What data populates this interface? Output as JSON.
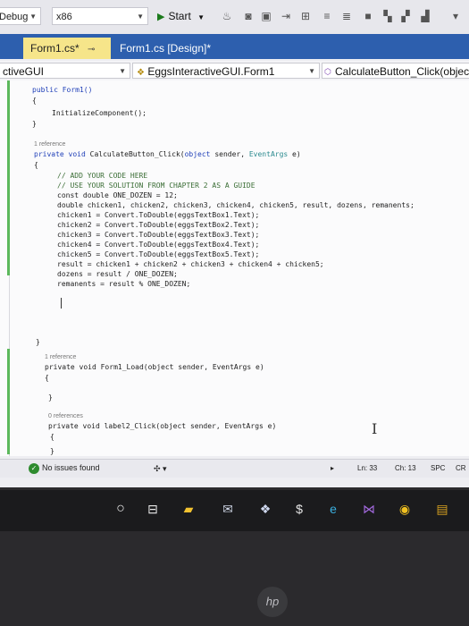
{
  "toolbar": {
    "config_combo": "Debug",
    "platform_combo": "x86",
    "start_label": "Start"
  },
  "tabs": {
    "active": "Form1.cs*",
    "inactive": "Form1.cs [Design]*"
  },
  "navbar": {
    "project": "ctiveGUI",
    "class": "EggsInteractiveGUI.Form1",
    "member": "CalculateButton_Click(object s"
  },
  "code": {
    "ctor_sig": "public Form1()",
    "brace_open": "{",
    "brace_close": "}",
    "init_call": "InitializeComponent();",
    "ref_1": "1 reference",
    "calc_sig_kw": "private void",
    "calc_sig_name": "CalculateButton_Click(",
    "calc_sig_type1": "object",
    "calc_sig_mid": " sender, ",
    "calc_sig_type2": "EventArgs",
    "calc_sig_end": " e)",
    "comment1": "// ADD YOUR CODE HERE",
    "comment2": "// USE YOUR SOLUTION FROM CHAPTER 2 AS A GUIDE",
    "line_const": "const double ONE_DOZEN = 12;",
    "line_double": "double chicken1, chicken2, chicken3, chicken4, chicken5, result, dozens, remanents;",
    "line_c1": "chicken1 = Convert.ToDouble(eggsTextBox1.Text);",
    "line_c2": "chicken2 = Convert.ToDouble(eggsTextBox2.Text);",
    "line_c3": "chicken3 = Convert.ToDouble(eggsTextBox3.Text);",
    "line_c4": "chicken4 = Convert.ToDouble(eggsTextBox4.Text);",
    "line_c5": "chicken5 = Convert.ToDouble(eggsTextBox5.Text);",
    "line_result": "result = chicken1 + chicken2 + chicken3 + chicken4 + chicken5;",
    "line_dozens": "dozens = result / ONE_DOZEN;",
    "line_remanents": "remanents = result % ONE_DOZEN;",
    "ref_2": "1 reference",
    "load_sig": "private void Form1_Load(object sender, EventArgs e)",
    "ref_3": "0 references",
    "label_sig": "private void label2_Click(object sender, EventArgs e)"
  },
  "statusbar": {
    "issues": "No issues found",
    "ln": "Ln: 33",
    "ch": "Ch: 13",
    "spc": "SPC",
    "crlf": "CR"
  },
  "taskbar": {
    "icons": [
      "search-icon",
      "task-view-icon",
      "file-explorer-icon",
      "mail-icon",
      "dropbox-icon",
      "dollar-icon",
      "edge-icon",
      "visual-studio-icon",
      "chrome-icon",
      "store-icon"
    ]
  },
  "bezel": {
    "logo": "hp"
  }
}
